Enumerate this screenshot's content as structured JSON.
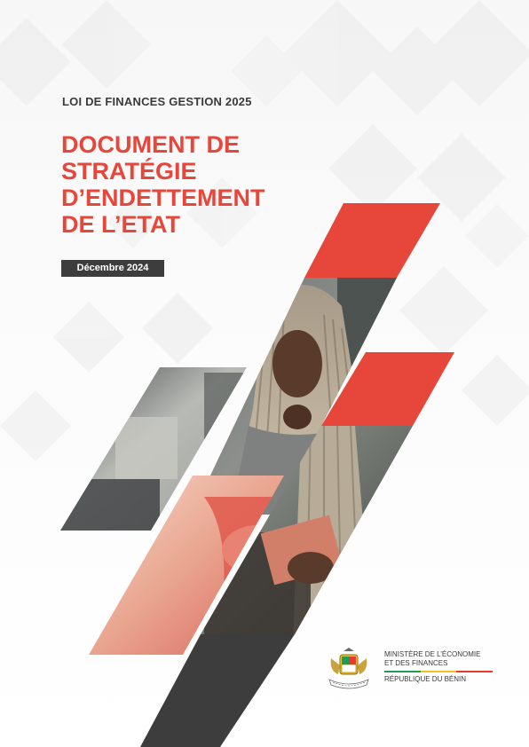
{
  "header": {
    "supertitle": "LOI DE FINANCES GESTION 2025",
    "title_lines": [
      "DOCUMENT DE",
      "STRATÉGIE",
      "D’ENDETTEMENT",
      "DE L’ETAT"
    ],
    "date": "Décembre 2024"
  },
  "ministry": {
    "line1": "MINISTÈRE DE L’ÉCONOMIE",
    "line2": "ET DES FINANCES",
    "republic": "RÉPUBLIQUE DU BÉNIN",
    "flag_colors": [
      "#1f9d55",
      "#f2c318",
      "#e63b2e"
    ]
  },
  "colors": {
    "accent_red": "#e6473a",
    "dark_gray": "#3d3d3d",
    "title_gray": "#3a3a3a"
  }
}
